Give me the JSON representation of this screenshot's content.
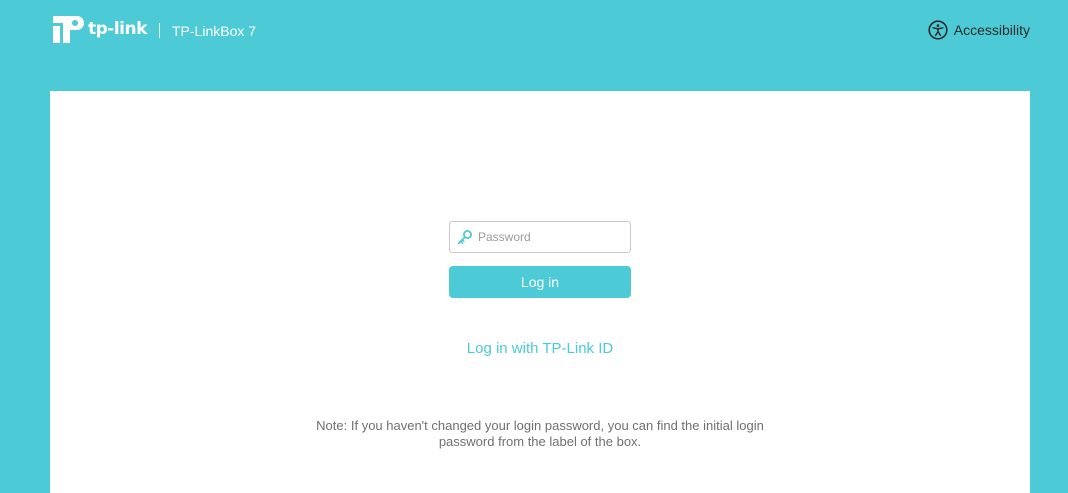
{
  "header": {
    "logo_text": "tp-link",
    "model_name": "TP-LinkBox 7",
    "accessibility_label": "Accessibility"
  },
  "login": {
    "password_placeholder": "Password",
    "password_value": "",
    "login_button_label": "Log in",
    "tplink_id_link": "Log in with TP-Link ID",
    "note_line1": "Note: If you haven't changed your login password, you can find the initial login",
    "note_line2": "password from the label of the box."
  },
  "colors": {
    "brand_teal": "#4ccad6",
    "card_background": "#ffffff",
    "note_text": "#707070"
  },
  "icons": {
    "logo": "tp-link-logo-icon",
    "accessibility": "accessibility-icon",
    "password": "key-icon"
  }
}
